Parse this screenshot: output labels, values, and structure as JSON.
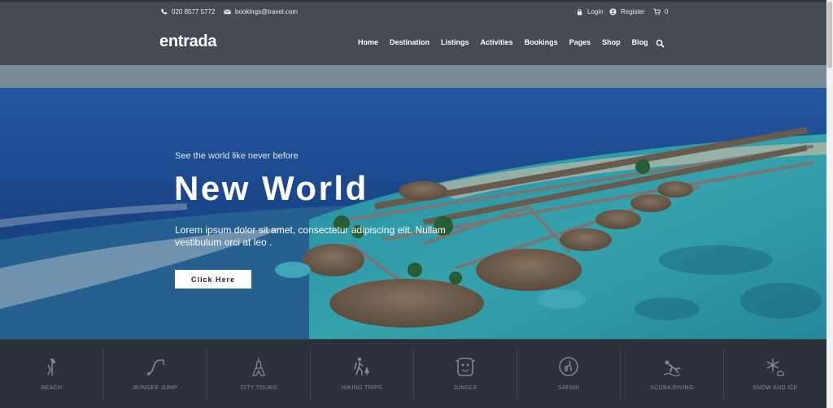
{
  "topbar": {
    "phone": "020 8577 5772",
    "email": "bookings@travel.com",
    "login": "Login",
    "register": "Register",
    "cart_count": "0"
  },
  "brand": {
    "logo": "entrada"
  },
  "nav": {
    "items": [
      "Home",
      "Destination",
      "Listings",
      "Activities",
      "Bookings",
      "Pages",
      "Shop",
      "Blog"
    ]
  },
  "hero": {
    "subtitle": "See the world like never before",
    "title": "New World",
    "description": "Lorem ipsum dolor sit amet, consectetur adipiscing elit. Nullam vestibulum orci at leo .",
    "button": "Click Here"
  },
  "categories": {
    "items": [
      {
        "label": "BEACH",
        "icon": "beach-icon"
      },
      {
        "label": "BUNGEE JUMP",
        "icon": "bungee-jump-icon"
      },
      {
        "label": "CITY TOURS",
        "icon": "city-tours-icon"
      },
      {
        "label": "HIKING TRIPS",
        "icon": "hiking-icon"
      },
      {
        "label": "JUNGLE",
        "icon": "jungle-icon"
      },
      {
        "label": "SAFARI",
        "icon": "safari-icon"
      },
      {
        "label": "SCUBA DIVING",
        "icon": "scuba-diving-icon"
      },
      {
        "label": "SNOW AND ICE",
        "icon": "snow-icon"
      }
    ]
  },
  "colors": {
    "header_bg": "#454b52",
    "category_bg": "#2b323b",
    "ocean_deep": "#1f4f9a",
    "lagoon": "#35b7c4"
  }
}
